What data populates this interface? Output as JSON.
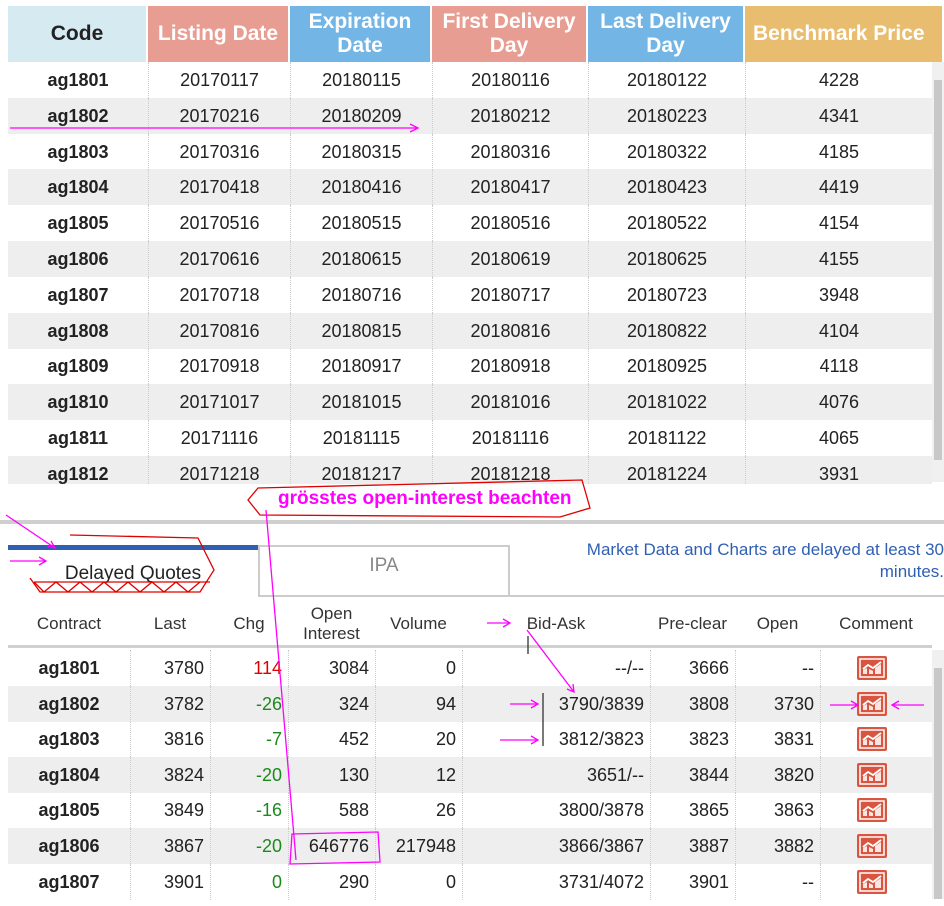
{
  "contracts_table": {
    "headers": [
      {
        "label": "Code",
        "color": "#d6eaf2",
        "text_color": "#222222"
      },
      {
        "label": "Listing Date",
        "color": "#e89d92",
        "text_color": "#ffffff"
      },
      {
        "label": "Expiration Date",
        "color": "#73b6e6",
        "text_color": "#ffffff"
      },
      {
        "label": "First Delivery Day",
        "color": "#e89d92",
        "text_color": "#ffffff"
      },
      {
        "label": "Last Delivery Day",
        "color": "#73b6e6",
        "text_color": "#ffffff"
      },
      {
        "label": "Benchmark Price",
        "color": "#e8bd6f",
        "text_color": "#ffffff"
      }
    ],
    "rows": [
      [
        "ag1801",
        "20170117",
        "20180115",
        "20180116",
        "20180122",
        "4228"
      ],
      [
        "ag1802",
        "20170216",
        "20180209",
        "20180212",
        "20180223",
        "4341"
      ],
      [
        "ag1803",
        "20170316",
        "20180315",
        "20180316",
        "20180322",
        "4185"
      ],
      [
        "ag1804",
        "20170418",
        "20180416",
        "20180417",
        "20180423",
        "4419"
      ],
      [
        "ag1805",
        "20170516",
        "20180515",
        "20180516",
        "20180522",
        "4154"
      ],
      [
        "ag1806",
        "20170616",
        "20180615",
        "20180619",
        "20180625",
        "4155"
      ],
      [
        "ag1807",
        "20170718",
        "20180716",
        "20180717",
        "20180723",
        "3948"
      ],
      [
        "ag1808",
        "20170816",
        "20180815",
        "20180816",
        "20180822",
        "4104"
      ],
      [
        "ag1809",
        "20170918",
        "20180917",
        "20180918",
        "20180925",
        "4118"
      ],
      [
        "ag1810",
        "20171017",
        "20181015",
        "20181016",
        "20181022",
        "4076"
      ],
      [
        "ag1811",
        "20171116",
        "20181115",
        "20181116",
        "20181122",
        "4065"
      ],
      [
        "ag1812",
        "20171218",
        "20181217",
        "20181218",
        "20181224",
        "3931"
      ]
    ]
  },
  "annotation": {
    "note": "grösstes open-interest beachten",
    "color": "#ff00ff"
  },
  "tabs": [
    {
      "label": "Delayed Quotes",
      "active": true
    },
    {
      "label": "IPA",
      "active": false
    }
  ],
  "delay_notice": "Market Data and Charts are delayed at least 30 minutes.",
  "quotes_table": {
    "headers": [
      "Contract",
      "Last",
      "Chg",
      "Open Interest",
      "Volume",
      "Bid-Ask",
      "Pre-clear",
      "Open",
      "Comment"
    ],
    "rows": [
      {
        "contract": "ag1801",
        "last": "3780",
        "chg": "114",
        "oi": "3084",
        "volume": "0",
        "bidask": "--/--",
        "preclear": "3666",
        "open": "--",
        "comment_icon": "chart-icon"
      },
      {
        "contract": "ag1802",
        "last": "3782",
        "chg": "-26",
        "oi": "324",
        "volume": "94",
        "bidask": "3790/3839",
        "preclear": "3808",
        "open": "3730",
        "comment_icon": "chart-icon"
      },
      {
        "contract": "ag1803",
        "last": "3816",
        "chg": "-7",
        "oi": "452",
        "volume": "20",
        "bidask": "3812/3823",
        "preclear": "3823",
        "open": "3831",
        "comment_icon": "chart-icon"
      },
      {
        "contract": "ag1804",
        "last": "3824",
        "chg": "-20",
        "oi": "130",
        "volume": "12",
        "bidask": "3651/--",
        "preclear": "3844",
        "open": "3820",
        "comment_icon": "chart-icon"
      },
      {
        "contract": "ag1805",
        "last": "3849",
        "chg": "-16",
        "oi": "588",
        "volume": "26",
        "bidask": "3800/3878",
        "preclear": "3865",
        "open": "3863",
        "comment_icon": "chart-icon"
      },
      {
        "contract": "ag1806",
        "last": "3867",
        "chg": "-20",
        "oi": "646776",
        "volume": "217948",
        "bidask": "3866/3867",
        "preclear": "3887",
        "open": "3882",
        "comment_icon": "chart-icon"
      },
      {
        "contract": "ag1807",
        "last": "3901",
        "chg": "0",
        "oi": "290",
        "volume": "0",
        "bidask": "3731/4072",
        "preclear": "3901",
        "open": "--",
        "comment_icon": "chart-icon"
      }
    ]
  },
  "colors": {
    "positive": "#e00000",
    "negative": "#1a8a1a",
    "accent": "#2f5fb3"
  }
}
